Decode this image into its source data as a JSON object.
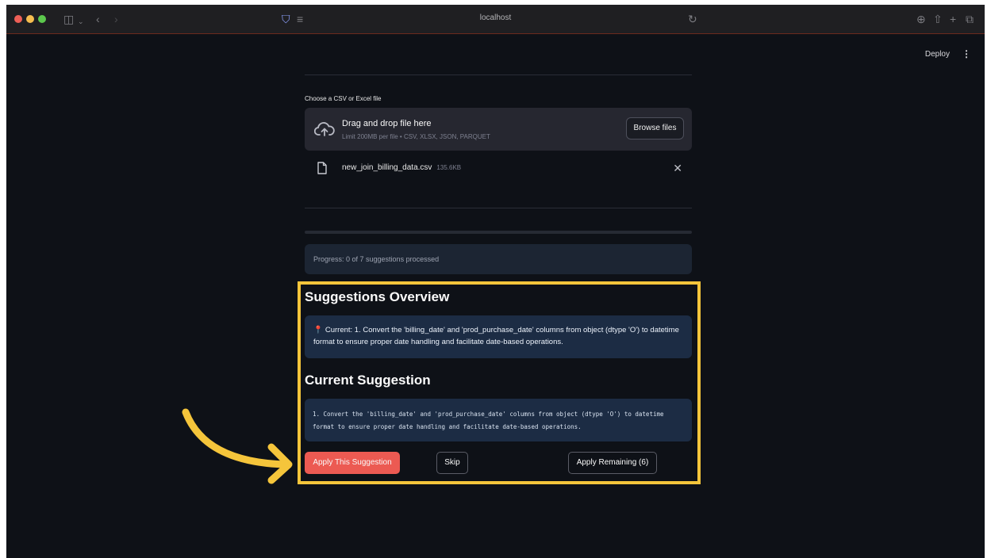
{
  "browser": {
    "url": "localhost"
  },
  "header": {
    "deploy_label": "Deploy",
    "menu_icon": "kebab-menu-icon"
  },
  "uploader": {
    "label": "Choose a CSV or Excel file",
    "drop_title": "Drag and drop file here",
    "drop_limit": "Limit 200MB per file • CSV, XLSX, JSON, PARQUET",
    "browse_label": "Browse files",
    "file": {
      "name": "new_join_billing_data.csv",
      "size": "135.6KB"
    }
  },
  "progress": {
    "text": "Progress: 0 of 7 suggestions processed",
    "processed": 0,
    "total": 7
  },
  "overview": {
    "heading": "Suggestions Overview",
    "current_text": "Current: 1. Convert the 'billing_date' and 'prod_purchase_date' columns from object (dtype 'O') to datetime format to ensure proper date handling and facilitate date-based operations."
  },
  "current_suggestion": {
    "heading": "Current Suggestion",
    "code": "1. Convert the 'billing_date' and 'prod_purchase_date' columns from object (dtype 'O') to datetime format to ensure proper date handling and facilitate date-based operations."
  },
  "actions": {
    "apply_label": "Apply This Suggestion",
    "skip_label": "Skip",
    "apply_remaining_label": "Apply Remaining (6)"
  },
  "colors": {
    "background": "#0e1117",
    "accent": "#ec5a52",
    "highlight": "#f5c53b",
    "info_box": "#1c2c44"
  }
}
